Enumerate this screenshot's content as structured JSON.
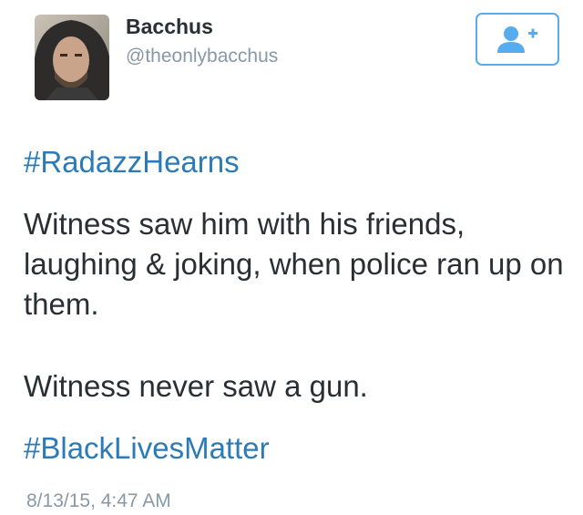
{
  "user": {
    "name": "Bacchus",
    "handle": "@theonlybacchus"
  },
  "follow_button": {
    "icon": "follow-user-plus-icon",
    "color": "#55acee"
  },
  "tweet": {
    "hashtag_top": "#RadazzHearns",
    "body": "Witness saw him with his friends, laughing & joking, when police ran up on them.",
    "body2": "Witness never saw a gun.",
    "hashtag_bottom": "#BlackLivesMatter",
    "timestamp": "8/13/15, 4:47 AM"
  },
  "colors": {
    "text": "#292f33",
    "hashtag": "#2b7bb9",
    "muted": "#8899a6"
  }
}
